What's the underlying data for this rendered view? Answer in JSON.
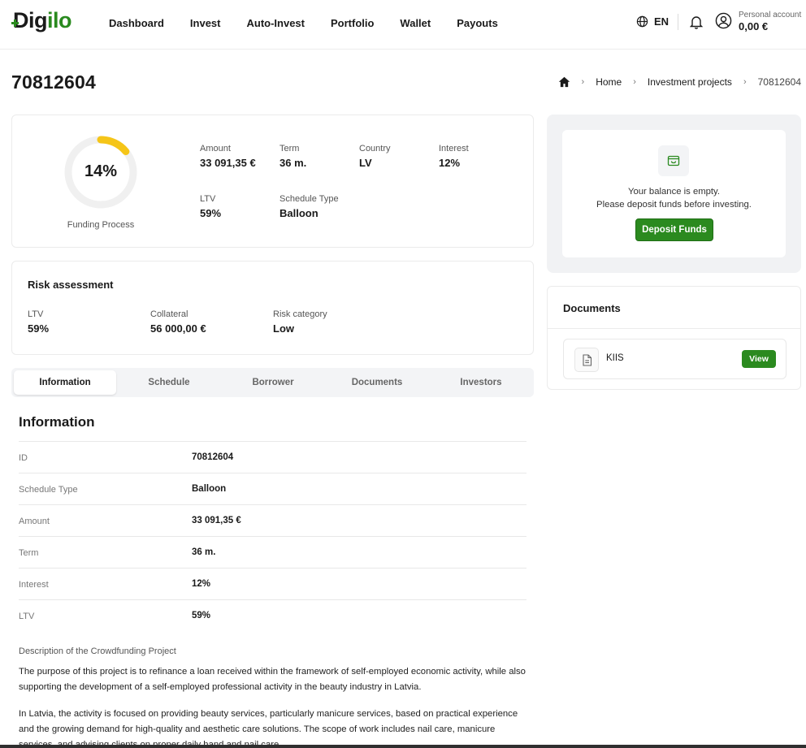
{
  "brand": {
    "name_a": "Dig",
    "name_b": "ilo",
    "accent": "#2a8a1f"
  },
  "nav": {
    "items": [
      "Dashboard",
      "Invest",
      "Auto-Invest",
      "Portfolio",
      "Wallet",
      "Payouts"
    ],
    "language": "EN",
    "account_label": "Personal account",
    "account_balance": "0,00 €",
    "icons": [
      "globe-icon",
      "bell-icon",
      "user-icon"
    ]
  },
  "page": {
    "title": "70812604"
  },
  "breadcrumb": {
    "home": "Home",
    "section": "Investment projects",
    "current": "70812604"
  },
  "summary": {
    "funding_percent": 14,
    "funding_percent_text": "14%",
    "funding_label": "Funding Process",
    "stats": [
      {
        "label": "Amount",
        "value": "33 091,35 €"
      },
      {
        "label": "Term",
        "value": "36 m."
      },
      {
        "label": "Country",
        "value": "LV"
      },
      {
        "label": "Interest",
        "value": "12%"
      },
      {
        "label": "LTV",
        "value": "59%"
      },
      {
        "label": "Schedule Type",
        "value": "Balloon"
      }
    ]
  },
  "risk": {
    "title": "Risk assessment",
    "items": [
      {
        "label": "LTV",
        "value": "59%"
      },
      {
        "label": "Collateral",
        "value": "56 000,00 €"
      },
      {
        "label": "Risk category",
        "value": "Low"
      }
    ]
  },
  "tabs": {
    "items": [
      "Information",
      "Schedule",
      "Borrower",
      "Documents",
      "Investors"
    ],
    "active": "Information"
  },
  "information": {
    "title": "Information",
    "rows": [
      {
        "label": "ID",
        "value": "70812604"
      },
      {
        "label": "Schedule Type",
        "value": "Balloon"
      },
      {
        "label": "Amount",
        "value": "33 091,35 €"
      },
      {
        "label": "Term",
        "value": "36 m."
      },
      {
        "label": "Interest",
        "value": "12%"
      },
      {
        "label": "LTV",
        "value": "59%"
      }
    ],
    "description_heading": "Description of the Crowdfunding Project",
    "paragraphs": [
      "The purpose of this project is to refinance a loan received within the framework of self-employed economic activity, while also supporting the development of a self-employed professional activity in the beauty industry in Latvia.",
      "In Latvia, the activity is focused on providing beauty services, particularly manicure services, based on practical experience and the growing demand for high-quality and aesthetic care solutions. The scope of work includes nail care, manicure services, and advising clients on proper daily hand and nail care."
    ]
  },
  "balance": {
    "line1": "Your balance is empty.",
    "line2": "Please deposit funds before investing.",
    "button": "Deposit Funds"
  },
  "documents": {
    "title": "Documents",
    "items": [
      {
        "name": "KIIS",
        "action": "View"
      }
    ]
  },
  "colors": {
    "green": "#2b8a1f",
    "progress": "#f5c518",
    "track": "#f0f0f0"
  }
}
